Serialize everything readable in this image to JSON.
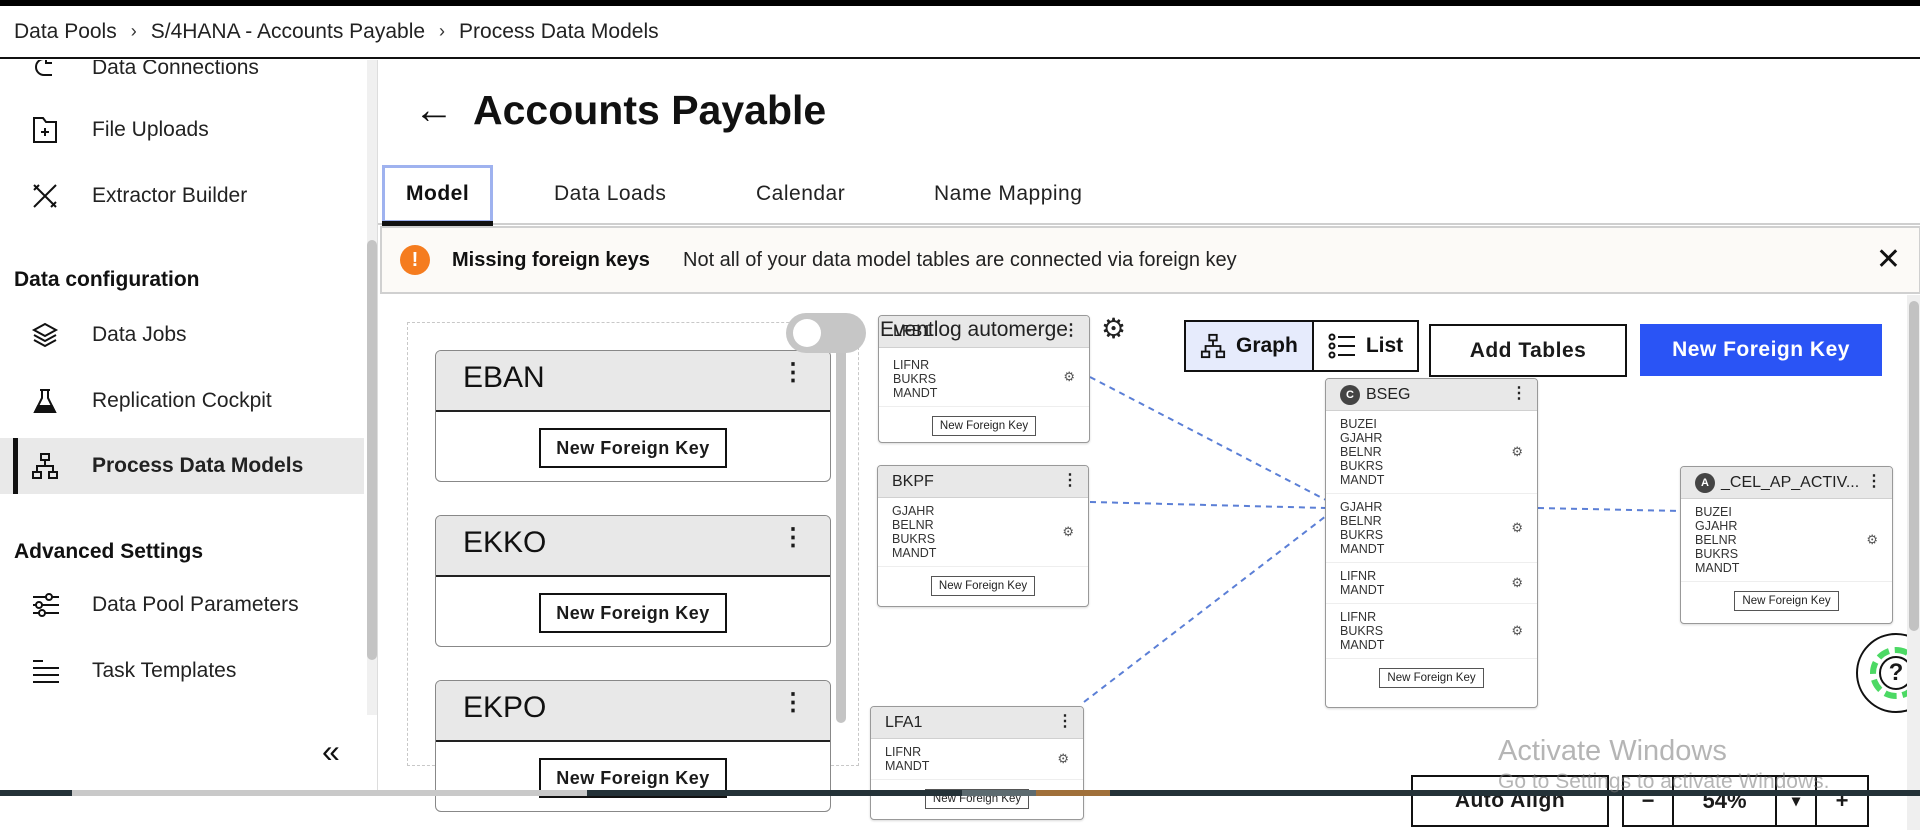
{
  "breadcrumb": [
    "Data Pools",
    "S/4HANA - Accounts Payable",
    "Process Data Models"
  ],
  "breadcrumb_separator": "›",
  "sidebar": {
    "items_top": [
      {
        "label": "Data Connections",
        "icon": "data-connections-icon"
      },
      {
        "label": "File Uploads",
        "icon": "folder-plus-icon"
      },
      {
        "label": "Extractor Builder",
        "icon": "tools-icon"
      }
    ],
    "section_data_config": "Data configuration",
    "items_data_config": [
      {
        "label": "Data Jobs",
        "icon": "layers-icon"
      },
      {
        "label": "Replication Cockpit",
        "icon": "flask-icon"
      },
      {
        "label": "Process Data Models",
        "icon": "hierarchy-icon",
        "active": true
      }
    ],
    "section_advanced": "Advanced Settings",
    "items_advanced": [
      {
        "label": "Data Pool Parameters",
        "icon": "sliders-icon"
      },
      {
        "label": "Task Templates",
        "icon": "list-icon"
      }
    ],
    "collapse_glyph": "«"
  },
  "page": {
    "back_glyph": "←",
    "title": "Accounts Payable",
    "tabs": [
      {
        "label": "Model",
        "active": true
      },
      {
        "label": "Data Loads"
      },
      {
        "label": "Calendar"
      },
      {
        "label": "Name Mapping"
      }
    ]
  },
  "banner": {
    "icon_glyph": "!",
    "title": "Missing foreign keys",
    "message": "Not all of your data model tables are connected via foreign key",
    "close_glyph": "✕",
    "accent": "#f57c1f"
  },
  "toolbar": {
    "eventlog_label": "Eventlog automerge",
    "eventlog_enabled": false,
    "view_options": [
      {
        "label": "Graph",
        "selected": true
      },
      {
        "label": "List"
      }
    ],
    "add_tables": "Add Tables",
    "new_foreign_key": "New Foreign Key",
    "primary_color": "#2a54f5",
    "auto_align": "Auto Align",
    "zoom_minus": "−",
    "zoom_value": "54%",
    "zoom_dropdown": "▾",
    "zoom_plus": "+"
  },
  "unconnected_tables": [
    {
      "name": "EBAN",
      "button": "New Foreign Key"
    },
    {
      "name": "EKKO",
      "button": "New Foreign Key"
    },
    {
      "name": "EKPO",
      "button": "New Foreign Key"
    }
  ],
  "graph_tables": {
    "lfb1": {
      "name": "LFB1",
      "groups": [
        [
          "LIFNR",
          "BUKRS",
          "MANDT"
        ]
      ],
      "button": "New Foreign Key"
    },
    "bkpf": {
      "name": "BKPF",
      "groups": [
        [
          "GJAHR",
          "BELNR",
          "BUKRS",
          "MANDT"
        ]
      ],
      "button": "New Foreign Key"
    },
    "lfa1": {
      "name": "LFA1",
      "groups": [
        [
          "LIFNR",
          "MANDT"
        ]
      ],
      "button": "New Foreign Key"
    },
    "bseg": {
      "name": "BSEG",
      "badge": "C",
      "groups": [
        [
          "BUZEI",
          "GJAHR",
          "BELNR",
          "BUKRS",
          "MANDT"
        ],
        [
          "GJAHR",
          "BELNR",
          "BUKRS",
          "MANDT"
        ],
        [
          "LIFNR",
          "MANDT"
        ],
        [
          "LIFNR",
          "BUKRS",
          "MANDT"
        ]
      ],
      "button": "New Foreign Key"
    },
    "activity": {
      "name": "_CEL_AP_ACTIV...",
      "badge": "A",
      "groups": [
        [
          "BUZEI",
          "GJAHR",
          "BELNR",
          "BUKRS",
          "MANDT"
        ]
      ],
      "button": "New Foreign Key"
    }
  },
  "connections": [
    [
      "LFB1",
      "BSEG"
    ],
    [
      "BKPF",
      "BSEG"
    ],
    [
      "LFA1",
      "BSEG"
    ],
    [
      "BSEG",
      "_CEL_AP_ACTIV..."
    ]
  ],
  "help": {
    "glyph": "?"
  },
  "watermark": {
    "line1": "Activate Windows",
    "line2": "Go to Settings to activate Windows."
  }
}
